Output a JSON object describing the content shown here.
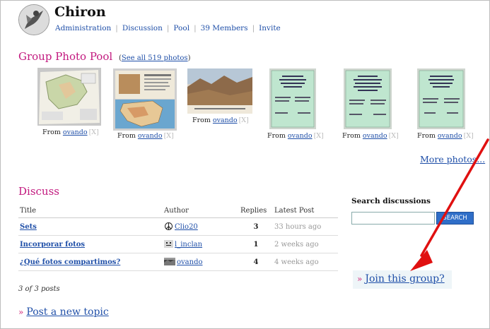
{
  "header": {
    "group_name": "Chiron",
    "nav": [
      "Administration",
      "Discussion",
      "Pool",
      "39 Members",
      "Invite"
    ]
  },
  "pool": {
    "title": "Group Photo Pool",
    "see_all_prefix": "(",
    "see_all": "See all 519 photos",
    "see_all_suffix": ")",
    "photos": [
      {
        "icon": "map-photo-thumbnail",
        "from": "From",
        "user": "ovando",
        "remove": "[X]"
      },
      {
        "icon": "iberia-map-photo-thumbnail",
        "from": "From",
        "user": "ovando",
        "remove": "[X]"
      },
      {
        "icon": "landscape-photo-thumbnail",
        "from": "From",
        "user": "ovando",
        "remove": "[X]"
      },
      {
        "icon": "document-photo-thumbnail",
        "from": "From",
        "user": "ovando",
        "remove": "[X]"
      },
      {
        "icon": "document-photo-thumbnail",
        "from": "From",
        "user": "ovando",
        "remove": "[X]"
      },
      {
        "icon": "document-photo-thumbnail",
        "from": "From",
        "user": "ovando",
        "remove": "[X]"
      }
    ],
    "more": "More photos..."
  },
  "discuss": {
    "title": "Discuss",
    "columns": [
      "Title",
      "Author",
      "Replies",
      "Latest Post"
    ],
    "rows": [
      {
        "title": "Sets",
        "author": "Clio20",
        "author_icon": "peace-sign-icon",
        "replies": "3",
        "latest": "33 hours ago"
      },
      {
        "title": "Incorporar fotos",
        "author": "l_inclan",
        "author_icon": "face-avatar-icon",
        "replies": "1",
        "latest": "2 weeks ago"
      },
      {
        "title": "¿Qué fotos compartimos?",
        "author": "ovando",
        "author_icon": "landscape-avatar-icon",
        "replies": "4",
        "latest": "4 weeks ago"
      }
    ],
    "count": "3 of 3 posts",
    "new_topic": "Post a new topic"
  },
  "search": {
    "label": "Search discussions",
    "value": "",
    "button": "SEARCH"
  },
  "join": {
    "marker": "»",
    "label": "Join this group?"
  },
  "colors": {
    "heading": "#c2187e",
    "link": "#1f4fa8",
    "annotation": "#e01010"
  }
}
